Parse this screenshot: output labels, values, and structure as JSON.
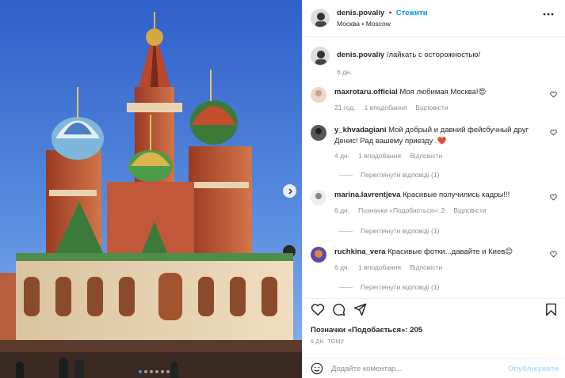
{
  "post": {
    "author": "denis.povaliy",
    "follow_label": "Стежити",
    "separator": "•",
    "location": "Москва • Moscow",
    "caption": "/лайкать с осторожностью/",
    "caption_time": "6 дн."
  },
  "carousel": {
    "slide_count": 6,
    "active_slide": 1
  },
  "comments": [
    {
      "username": "maxrotaru.official",
      "text": "Моя любимая Москва!😍",
      "time": "21 год.",
      "likes": "1 вподобання",
      "reply": "Відповісти",
      "view_replies": ""
    },
    {
      "username": "y_khvadagiani",
      "text": "Мой добрый и давний фейсбучный друг Денис! Рад вашему приезду .❤️",
      "time": "4 дн.",
      "likes": "1 вподобання",
      "reply": "Відповісти",
      "view_replies": "Переглянути відповіді (1)"
    },
    {
      "username": "marina.lavrentjeva",
      "text": "Красивые получились кадры!!!",
      "time": "6 дн.",
      "likes": "Позначки «Подобається»: 2",
      "reply": "Відповісти",
      "view_replies": "Переглянути відповіді (1)"
    },
    {
      "username": "ruchkina_vera",
      "text": "Красивые фотки...давайте и Киев😊",
      "time": "6 дн.",
      "likes": "1 вподобання",
      "reply": "Відповісти",
      "view_replies": "Переглянути відповіді (1)"
    }
  ],
  "footer": {
    "likes": "Позначки «Подобається»: 205",
    "ago": "6 ДН. ТОМУ",
    "comment_placeholder": "Додайте коментар...",
    "publish_label": "Опублікувати"
  },
  "colors": {
    "accent": "#0095f6",
    "sky": "#3f6fd0",
    "muted": "#8e8e8e"
  }
}
